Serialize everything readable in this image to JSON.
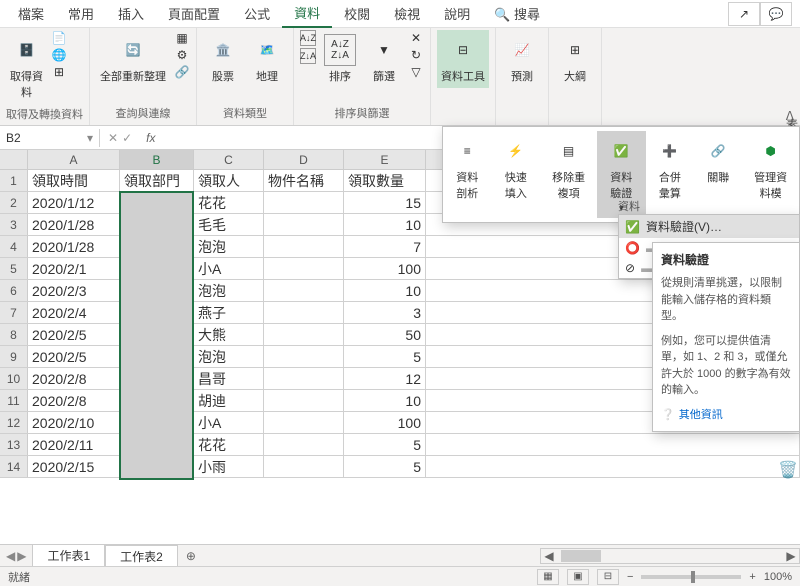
{
  "tabs": [
    "檔案",
    "常用",
    "插入",
    "頁面配置",
    "公式",
    "資料",
    "校閱",
    "檢視",
    "說明",
    "搜尋"
  ],
  "active_tab": "資料",
  "ribbon_groups": {
    "g1": {
      "label": "取得及轉換資料",
      "btn": "取得資\n料"
    },
    "g2": {
      "label": "查詢與連線",
      "btn": "全部重新整理"
    },
    "g3": {
      "label": "資料類型",
      "btn1": "股票",
      "btn2": "地理"
    },
    "g4": {
      "label": "排序與篩選",
      "sort": "排序",
      "filter": "篩選"
    },
    "g5": {
      "label": "資料工具",
      "btn": "資料工具"
    },
    "g6": {
      "label": "預測",
      "btn": "預測"
    },
    "g7": {
      "label": "大綱",
      "btn": "大綱"
    }
  },
  "popup": {
    "items": [
      "資料剖析",
      "快速填入",
      "移除重複項",
      "資料驗證",
      "合併彙算",
      "關聯",
      "管理資料模"
    ]
  },
  "menu": {
    "label": "資料",
    "item1": "資料驗證(V)…"
  },
  "tooltip": {
    "title": "資料驗證",
    "body1": "從規則清單挑選，以限制能輸入儲存格的資料類型。",
    "body2": "例如，您可以提供值清單，如 1、2 和 3，或僅允許大於 1000 的數字為有效的輸入。",
    "link": "其他資訊"
  },
  "name_box": "B2",
  "columns": [
    "A",
    "B",
    "C",
    "D",
    "E"
  ],
  "headers": {
    "A": "領取時間",
    "B": "領取部門",
    "C": "領取人",
    "D": "物件名稱",
    "E": "領取數量"
  },
  "rows": [
    {
      "A": "2020/1/12",
      "C": "花花",
      "E": "15"
    },
    {
      "A": "2020/1/28",
      "C": "毛毛",
      "E": "10"
    },
    {
      "A": "2020/1/28",
      "C": "泡泡",
      "E": "7"
    },
    {
      "A": "2020/2/1",
      "C": "小A",
      "E": "100"
    },
    {
      "A": "2020/2/3",
      "C": "泡泡",
      "E": "10"
    },
    {
      "A": "2020/2/4",
      "C": "燕子",
      "E": "3"
    },
    {
      "A": "2020/2/5",
      "C": "大熊",
      "E": "50"
    },
    {
      "A": "2020/2/5",
      "C": "泡泡",
      "E": "5"
    },
    {
      "A": "2020/2/8",
      "C": "昌哥",
      "E": "12"
    },
    {
      "A": "2020/2/8",
      "C": "胡迪",
      "E": "10"
    },
    {
      "A": "2020/2/10",
      "C": "小A",
      "E": "100"
    },
    {
      "A": "2020/2/11",
      "C": "花花",
      "E": "5"
    },
    {
      "A": "2020/2/15",
      "C": "小雨",
      "E": "5"
    }
  ],
  "sheets": [
    "工作表1",
    "工作表2"
  ],
  "status": "就緒",
  "zoom": "100%",
  "side_label": "素"
}
